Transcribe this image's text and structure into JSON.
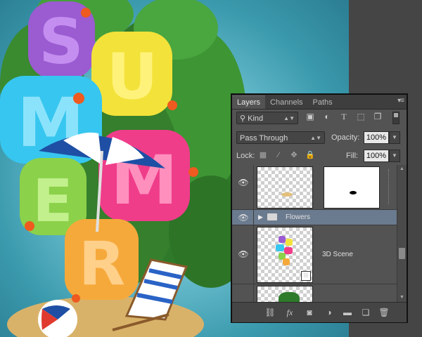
{
  "canvas": {
    "artwork_letters": [
      "S",
      "U",
      "M",
      "M",
      "E",
      "R"
    ],
    "letter_colors": [
      "#9b5bd1",
      "#f3e23a",
      "#37c6ef",
      "#ef3d8a",
      "#8bd14a",
      "#f6a93b"
    ]
  },
  "layers_panel": {
    "tabs": [
      {
        "label": "Layers",
        "active": true
      },
      {
        "label": "Channels",
        "active": false
      },
      {
        "label": "Paths",
        "active": false
      }
    ],
    "menu_icon": "panel-menu-icon",
    "filter": {
      "kind_label": "Kind",
      "icons": [
        "image-icon",
        "adjustment-icon",
        "type-icon",
        "shape-icon",
        "smart-object-icon"
      ]
    },
    "blend_mode": "Pass Through",
    "opacity_label": "Opacity:",
    "opacity_value": "100%",
    "lock_label": "Lock:",
    "fill_label": "Fill:",
    "fill_value": "100%",
    "layers": [
      {
        "name": "",
        "type": "layer-with-mask",
        "visible": true,
        "selected": false
      },
      {
        "name": "Flowers",
        "type": "group",
        "visible": true,
        "selected": true
      },
      {
        "name": "3D Scene",
        "type": "smart-object",
        "visible": true,
        "selected": false
      },
      {
        "name": "",
        "type": "layer",
        "visible": true,
        "selected": false
      }
    ],
    "bottom_icons": [
      "link-icon",
      "fx-icon",
      "add-mask-icon",
      "adjustment-layer-icon",
      "new-group-icon",
      "new-layer-icon",
      "delete-icon"
    ],
    "fx_label": "fx"
  }
}
